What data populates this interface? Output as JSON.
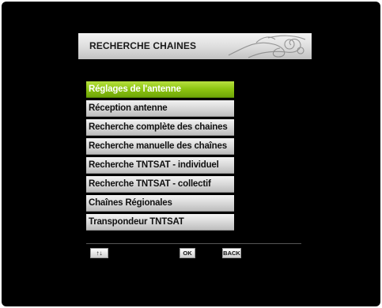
{
  "header": {
    "title": "RECHERCHE CHAINES"
  },
  "menu": {
    "selected_index": 0,
    "items": [
      {
        "label": "Réglages de l'antenne"
      },
      {
        "label": "Réception antenne"
      },
      {
        "label": "Recherche complète des chaines"
      },
      {
        "label": "Recherche manuelle des chaînes"
      },
      {
        "label": "Recherche TNTSAT - individuel"
      },
      {
        "label": "Recherche TNTSAT - collectif"
      },
      {
        "label": "Chaînes Régionales"
      },
      {
        "label": "Transpondeur TNTSAT"
      }
    ]
  },
  "footer": {
    "keys": [
      {
        "label": "↑↓",
        "icon": "up-down-arrows-icon"
      },
      {
        "label": "OK",
        "icon": "ok-key"
      },
      {
        "label": "BACK",
        "icon": "back-key"
      }
    ]
  },
  "colors": {
    "selected": "#8cc410",
    "item": "#d9d9d9",
    "background": "#000000"
  }
}
